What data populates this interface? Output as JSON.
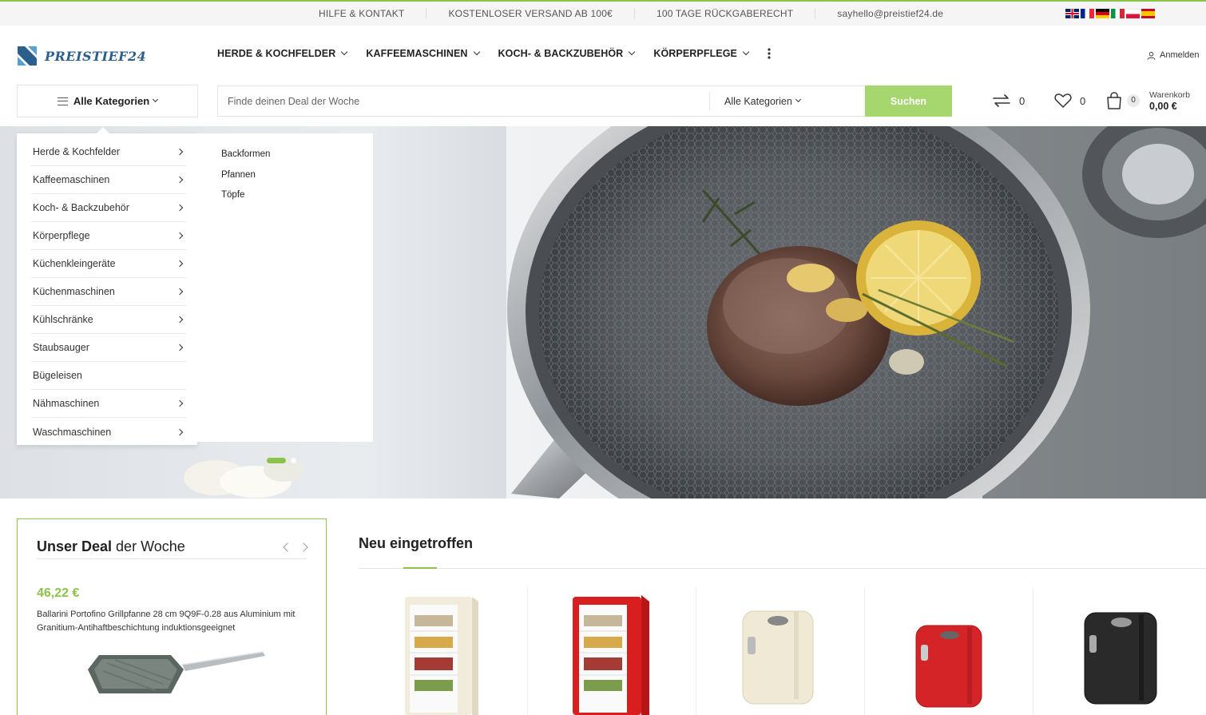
{
  "topbar": {
    "links": [
      "HILFE & KONTAKT",
      "KOSTENLOSER VERSAND AB 100€",
      "100 TAGE RÜCKGABERECHT",
      "sayhello@preistief24.de"
    ],
    "languages": [
      "en",
      "fr",
      "de",
      "it",
      "pl",
      "es"
    ]
  },
  "header": {
    "logo_text": "PREISTIEF24",
    "nav": [
      "HERDE & KOCHFELDER",
      "KAFFEEMASCHINEN",
      "KOCH- & BACKZUBEHÖR",
      "KÖRPERPFLEGE"
    ],
    "login_label": "Anmelden"
  },
  "search": {
    "all_categories_button": "Alle Kategorien",
    "placeholder": "Finde deinen Deal der Woche",
    "category_select": "Alle Kategorien",
    "button_label": "Suchen"
  },
  "header_icons": {
    "compare_count": "0",
    "wishlist_count": "0",
    "cart_count": "0",
    "cart_label": "Warenkorb",
    "cart_total": "0,00 €"
  },
  "category_menu": {
    "items": [
      {
        "label": "Herde & Kochfelder",
        "has_sub": true
      },
      {
        "label": "Kaffeemaschinen",
        "has_sub": true
      },
      {
        "label": "Koch- & Backzubehör",
        "has_sub": true
      },
      {
        "label": "Körperpflege",
        "has_sub": true
      },
      {
        "label": "Küchenkleingeräte",
        "has_sub": true
      },
      {
        "label": "Küchenmaschinen",
        "has_sub": true
      },
      {
        "label": "Kühlschränke",
        "has_sub": true
      },
      {
        "label": "Staubsauger",
        "has_sub": true
      },
      {
        "label": "Bügeleisen",
        "has_sub": false
      },
      {
        "label": "Nähmaschinen",
        "has_sub": true
      },
      {
        "label": "Waschmaschinen",
        "has_sub": true
      }
    ],
    "submenu": [
      "Backformen",
      "Pfannen",
      "Töpfe"
    ]
  },
  "hero": {
    "slide_count": 2,
    "active_slide": 1
  },
  "deal": {
    "title_bold": "Unser Deal",
    "title_rest": " der Woche",
    "price": "46,22 €",
    "product_name": "Ballarini Portofino Grillpfanne 28 cm 9Q9F-0.28 aus Aluminium mit Granitium-Antihaftbeschichtung induktionsgeeignet"
  },
  "new_arrivals": {
    "title": "Neu eingetroffen",
    "products": [
      {
        "image": "fridge-cream-open"
      },
      {
        "image": "fridge-red-open"
      },
      {
        "image": "fridge-cream-retro"
      },
      {
        "image": "fridge-red-retro"
      },
      {
        "image": "fridge-black-retro"
      }
    ]
  },
  "colors": {
    "accent_green": "#8bc34a",
    "search_button": "#a5d76e",
    "logo_blue": "#2b5f8c"
  }
}
